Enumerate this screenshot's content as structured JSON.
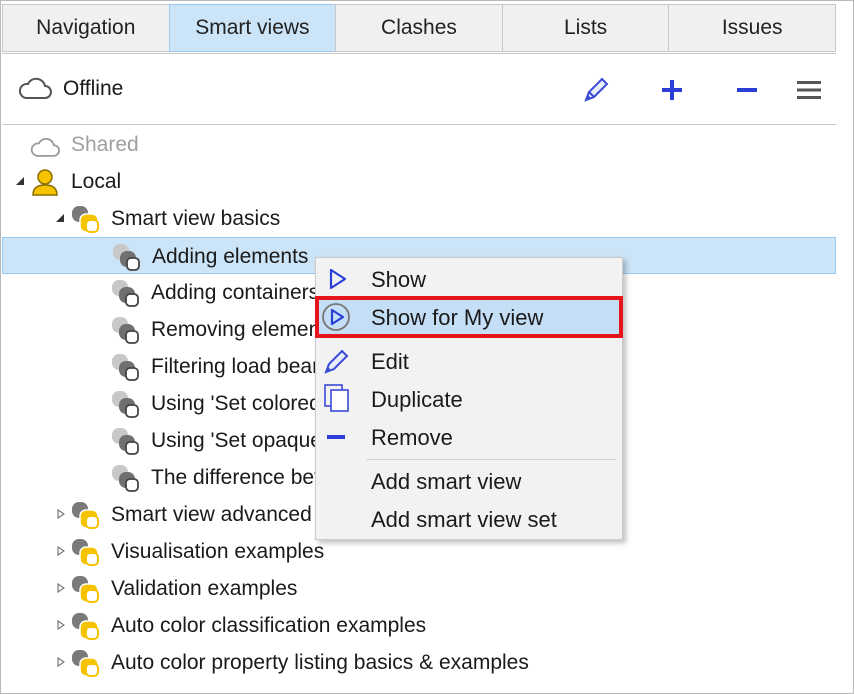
{
  "tabs": [
    {
      "label": "Navigation",
      "active": false
    },
    {
      "label": "Smart views",
      "active": true
    },
    {
      "label": "Clashes",
      "active": false
    },
    {
      "label": "Lists",
      "active": false
    },
    {
      "label": "Issues",
      "active": false
    }
  ],
  "toolbar": {
    "status_icon": "cloud-icon",
    "status_text": "Offline",
    "buttons": [
      "edit-pencil-icon",
      "plus-icon",
      "minus-icon",
      "hamburger-menu-icon"
    ]
  },
  "tree": {
    "shared": "Shared",
    "local": "Local",
    "basics_folder": "Smart view basics",
    "basics_items": [
      "Adding elements",
      "Adding containers",
      "Removing elemen",
      "Filtering load bear",
      "Using 'Set colored",
      "Using 'Set opaque",
      "The difference bet"
    ],
    "folders": [
      "Smart view advanced",
      "Visualisation examples",
      "Validation examples",
      "Auto color classification examples",
      "Auto color property listing basics & examples"
    ]
  },
  "context_menu": {
    "items": [
      {
        "label": "Show",
        "icon": "play-outline-icon"
      },
      {
        "label": "Show for My view",
        "icon": "play-circle-icon",
        "highlighted": true
      },
      {
        "label": "Edit",
        "icon": "pencil-icon"
      },
      {
        "label": "Duplicate",
        "icon": "duplicate-icon"
      },
      {
        "label": "Remove",
        "icon": "minus-icon"
      },
      {
        "label": "Add smart view",
        "icon": ""
      },
      {
        "label": "Add smart view set",
        "icon": ""
      }
    ]
  },
  "colors": {
    "accent_blue": "#2b3fd6",
    "selection": "#cce4f7",
    "folder_yellow": "#f6c300",
    "highlight_red": "#e8141c"
  }
}
